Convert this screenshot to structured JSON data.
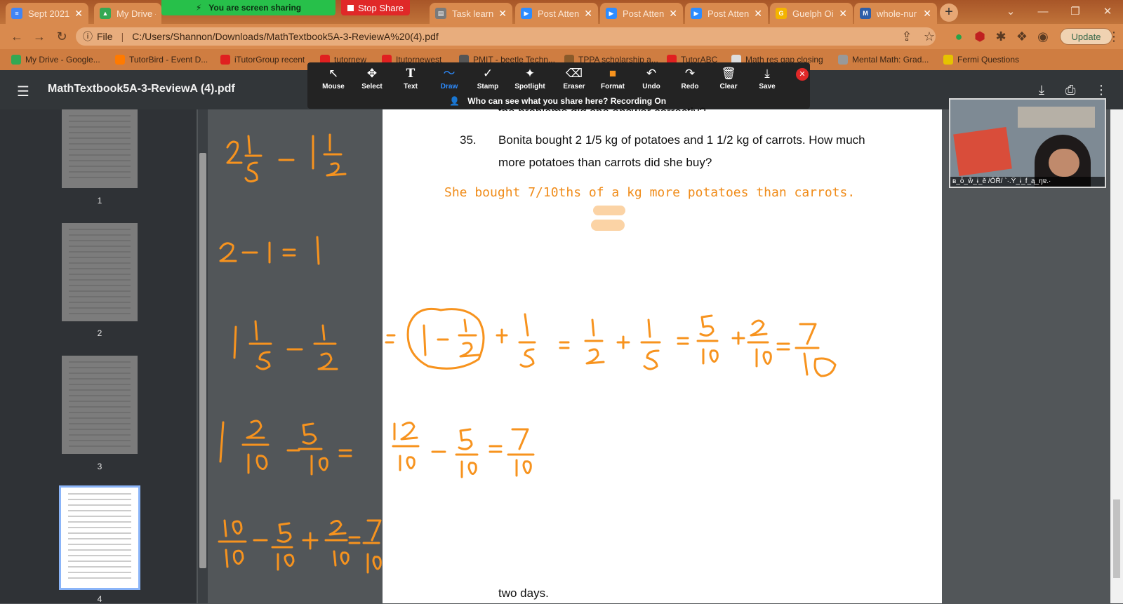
{
  "browser": {
    "tabs": [
      {
        "label": "Sept 2021",
        "icon": "docs-icon",
        "color": "#4285f4"
      },
      {
        "label": "My Drive -",
        "icon": "drive-icon",
        "color": "#34a853"
      },
      {
        "label": "Task learn",
        "icon": "task-icon",
        "color": "#7a7a7a"
      },
      {
        "label": "Post Atten",
        "icon": "zoom-icon",
        "color": "#2d8cff"
      },
      {
        "label": "Post Atten",
        "icon": "zoom-icon",
        "color": "#2d8cff"
      },
      {
        "label": "Post Atten",
        "icon": "zoom-icon",
        "color": "#2d8cff"
      },
      {
        "label": "Guelph Oi",
        "icon": "globe-icon",
        "color": "#f4b400"
      },
      {
        "label": "whole-nur",
        "icon": "mw-icon",
        "color": "#2e5ea8"
      }
    ],
    "screen_share": {
      "status": "You are screen sharing",
      "stop_label": "Stop Share"
    },
    "address": {
      "prefix": "File",
      "url": "C:/Users/Shannon/Downloads/MathTextbook5A-3-ReviewA%20(4).pdf"
    },
    "update_label": "Update",
    "bookmarks": [
      {
        "label": "My Drive - Google...",
        "color": "#34a853"
      },
      {
        "label": "TutorBird - Event D...",
        "color": "#ff7a00"
      },
      {
        "label": "iTutorGroup recent",
        "color": "#e02020"
      },
      {
        "label": "tutornew",
        "color": "#e02020"
      },
      {
        "label": "Itutornewest",
        "color": "#e02020"
      },
      {
        "label": "PMIT - beetle Techn...",
        "color": "#555555"
      },
      {
        "label": "TPPA scholarship a...",
        "color": "#8a5a2a"
      },
      {
        "label": "TutorABC",
        "color": "#e02020"
      },
      {
        "label": "Math res gap closing",
        "color": "#dddddd"
      },
      {
        "label": "Mental Math: Grad...",
        "color": "#999999"
      },
      {
        "label": "Fermi Questions",
        "color": "#e6c300"
      }
    ]
  },
  "pdf": {
    "title": "MathTextbook5A-3-ReviewA (4).pdf",
    "pages": [
      "1",
      "2",
      "3",
      "4"
    ],
    "question": {
      "number": "35.",
      "line1": "Bonita bought 2 1/5 kg of potatoes and 1 1/2 kg of carrots. How much",
      "line2": "more potatoes than carrots did she buy?",
      "cut_line": "the problems did she answer correctly?"
    },
    "answer": "She bought 7/10ths of a kg more potatoes than carrots.",
    "footer_text": "two days."
  },
  "annotate": {
    "tools": [
      {
        "label": "Mouse",
        "icon": "↖"
      },
      {
        "label": "Select",
        "icon": "✥"
      },
      {
        "label": "Text",
        "icon": "T"
      },
      {
        "label": "Draw",
        "icon": "〜"
      },
      {
        "label": "Stamp",
        "icon": "✓"
      },
      {
        "label": "Spotlight",
        "icon": "✦"
      },
      {
        "label": "Eraser",
        "icon": "⌫"
      },
      {
        "label": "Format",
        "icon": "■"
      },
      {
        "label": "Undo",
        "icon": "↶"
      },
      {
        "label": "Redo",
        "icon": "↷"
      },
      {
        "label": "Clear",
        "icon": "🗑"
      },
      {
        "label": "Save",
        "icon": "⤓"
      }
    ],
    "recording_note": "Who can see what you share here? Recording On",
    "active_tool": "Draw",
    "active_color": "#2d8cff"
  },
  "webcam": {
    "name": "ʙ_ȱ_ẘ_ɨ_ě /ŌŘ/ `·.Ÿ_ɨ_f_ą_ŋɐ.·"
  },
  "ink_color": "#f7931e"
}
